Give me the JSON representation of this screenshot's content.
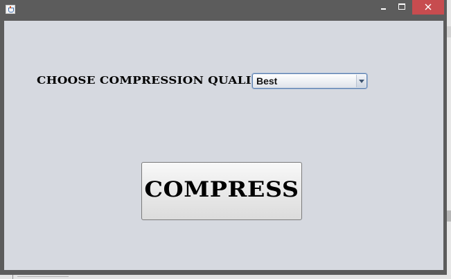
{
  "window": {
    "icon": "java-cup-icon",
    "controls": {
      "minimize_icon": "minimize-icon",
      "maximize_icon": "maximize-icon",
      "close_icon": "close-icon",
      "close_color": "#c74c4f"
    }
  },
  "form": {
    "quality_label": "CHOOSE COMPRESSION QUALITY:",
    "quality_value": "Best",
    "dropdown_icon": "chevron-down-icon"
  },
  "actions": {
    "compress_label": "COMPRESS"
  },
  "colors": {
    "panel_background": "#d6d9e0",
    "titlebar": "#5c5c5c",
    "select_border": "#5c7fae"
  }
}
